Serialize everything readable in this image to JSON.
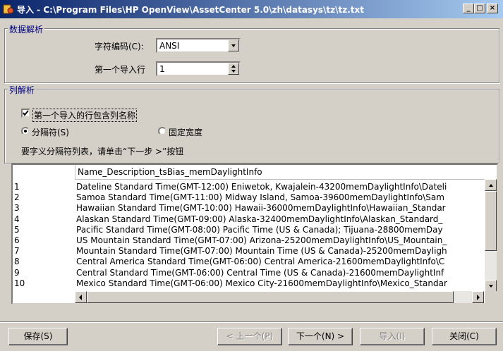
{
  "window": {
    "title": "导入 - C:\\Program Files\\HP OpenView\\AssetCenter 5.0\\zh\\datasys\\tz\\tz.txt",
    "icon": "app-icon",
    "controls": {
      "minimize": "_",
      "maximize": "□",
      "close": "×"
    }
  },
  "data_parsing": {
    "legend": "数据解析",
    "encoding_label": "字符编码(C):",
    "encoding_value": "ANSI",
    "first_row_label": "第一个导入行",
    "first_row_value": "1"
  },
  "column_parsing": {
    "legend": "列解析",
    "header_checkbox_label": "第一个导入的行包含列名称",
    "header_checked": true,
    "separator_label": "分隔符(S)",
    "fixed_width_label": "固定宽度",
    "selected": "separator",
    "hint": "要字义分隔符列表，请单击“下一步 >”按钮"
  },
  "preview": {
    "column_header": "Name_Description_tsBias_memDaylightInfo",
    "row_numbers": [
      "1",
      "2",
      "3",
      "4",
      "5",
      "6",
      "7",
      "8",
      "9",
      "10"
    ],
    "rows": [
      "Dateline Standard Time(GMT-12:00) Eniwetok, Kwajalein-43200memDaylightInfo\\Dateli",
      "Samoa Standard Time(GMT-11:00) Midway Island, Samoa-39600memDaylightInfo\\Sam",
      "Hawaiian Standard Time(GMT-10:00) Hawaii-36000memDaylightInfo\\Hawaiian_Standar",
      "Alaskan Standard Time(GMT-09:00) Alaska-32400memDaylightInfo\\Alaskan_Standard_",
      "Pacific Standard Time(GMT-08:00) Pacific Time (US & Canada); Tijuana-28800memDay",
      "US Mountain Standard Time(GMT-07:00) Arizona-25200memDaylightInfo\\US_Mountain_",
      "Mountain Standard Time(GMT-07:00) Mountain Time (US & Canada)-25200memDayligh",
      "Central America Standard Time(GMT-06:00) Central America-21600memDaylightInfo\\C",
      "Central Standard Time(GMT-06:00) Central Time (US & Canada)-21600memDaylightInf",
      "Mexico Standard Time(GMT-06:00) Mexico City-21600memDaylightInfo\\Mexico_Standar"
    ]
  },
  "buttons": {
    "save": "保存(S)",
    "prev": "< 上一个(P)",
    "next": "下一个(N) >",
    "import": "导入(I)",
    "close": "关闭(C)"
  }
}
